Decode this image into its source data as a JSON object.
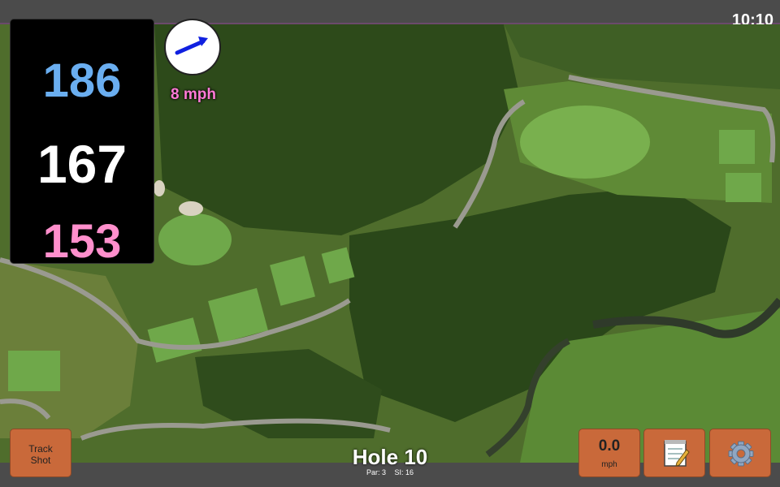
{
  "status_bar": {
    "time": "10:10"
  },
  "distances": {
    "back": "186",
    "middle": "167",
    "front": "153"
  },
  "wind": {
    "speed_label": "8 mph",
    "icon": "wind-direction-arrow-icon"
  },
  "hole": {
    "title": "Hole 10",
    "par": "Par: 3",
    "stroke_index": "SI: 16"
  },
  "buttons": {
    "track_shot": "Track\nShot",
    "speed_value": "0.0",
    "speed_unit": "mph",
    "notes_icon": "notepad-icon",
    "settings_icon": "gear-icon"
  },
  "colors": {
    "back": "#6aaef0",
    "middle": "#ffffff",
    "front": "#ff8fcc",
    "button": "#c9693a",
    "wind_text": "#ff7ad6"
  }
}
